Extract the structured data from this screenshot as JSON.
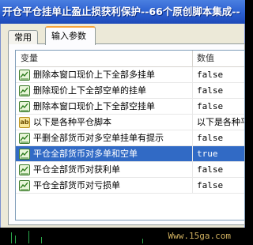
{
  "window": {
    "title": "开仓平仓挂单止盈止损获利保护--66个原创脚本集成--"
  },
  "tabs": [
    {
      "label": "常用"
    },
    {
      "label": "输入参数"
    }
  ],
  "table": {
    "headers": [
      "变量",
      "数值"
    ],
    "rows": [
      {
        "icon": "chart-icon",
        "name": "删除本窗口现价上下全部多挂单",
        "value": "false",
        "selected": false
      },
      {
        "icon": "chart-icon",
        "name": "删除现价上下全部空单的挂单",
        "value": "false",
        "selected": false
      },
      {
        "icon": "chart-icon",
        "name": "删除本窗口现价上下全部空挂单",
        "value": "false",
        "selected": false
      },
      {
        "icon": "ab-icon",
        "name": "以下是各种平仓脚本",
        "value": "以下是各种平",
        "selected": false
      },
      {
        "icon": "chart-icon",
        "name": "平删全部货币对多空单挂单有提示",
        "value": "false",
        "selected": false
      },
      {
        "icon": "chart-icon",
        "name": "平仓全部货币对多单和空单",
        "value": "true",
        "selected": true
      },
      {
        "icon": "chart-icon",
        "name": "平仓全部货币对获利单",
        "value": "false",
        "selected": false
      },
      {
        "icon": "chart-icon",
        "name": "平仓全部货币对亏损单",
        "value": "false",
        "selected": false
      }
    ]
  },
  "footer": {
    "watermark": "Www.15ga.com"
  },
  "colors": {
    "selection": "#316ac5",
    "titlebar": "#2b5fd0",
    "active_tab_accent": "#f8a33a"
  }
}
